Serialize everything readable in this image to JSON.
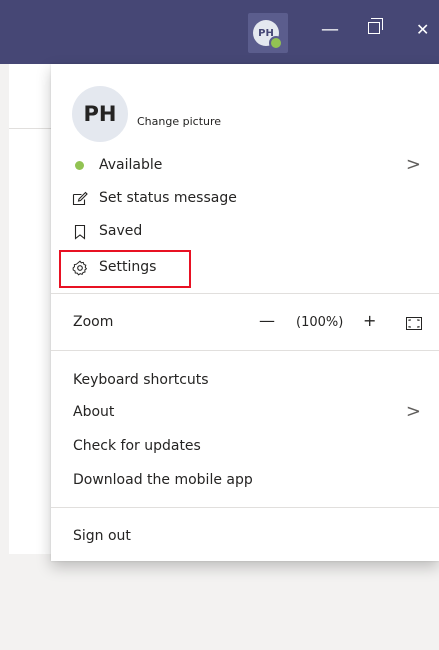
{
  "titlebar": {
    "avatar_initials": "PH",
    "minimize_glyph": "—",
    "close_glyph": "✕",
    "accent": "#464775",
    "status_color": "#92c353"
  },
  "menu": {
    "profile": {
      "initials": "PH",
      "change_picture": "Change picture"
    },
    "status": {
      "label": "Available",
      "chevron": ">"
    },
    "set_status": "Set status message",
    "saved": "Saved",
    "settings": "Settings",
    "zoom": {
      "label": "Zoom",
      "minus": "—",
      "value": "(100%)",
      "plus": "+"
    },
    "keyboard_shortcuts": "Keyboard shortcuts",
    "about": {
      "label": "About",
      "chevron": ">"
    },
    "check_updates": "Check for updates",
    "download_mobile": "Download the mobile app",
    "sign_out": "Sign out"
  },
  "icons": [
    "status-available-icon",
    "edit-status-icon",
    "bookmark-icon",
    "gear-icon",
    "fullscreen-icon",
    "chevron-right-icon"
  ],
  "highlight_color": "#e81123"
}
